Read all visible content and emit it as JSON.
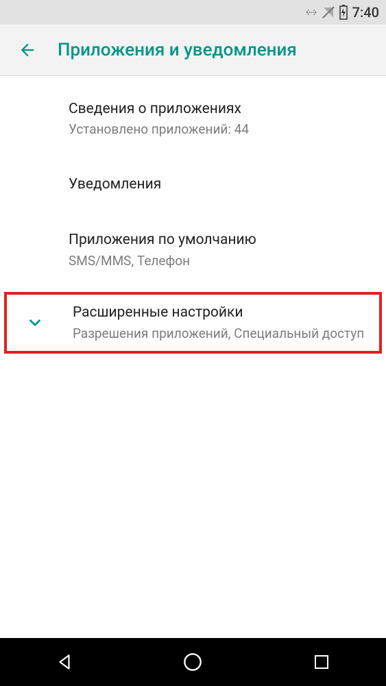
{
  "status": {
    "time": "7:40"
  },
  "header": {
    "title": "Приложения и уведомления"
  },
  "items": [
    {
      "title": "Сведения о приложениях",
      "subtitle": "Установлено приложений: 44"
    },
    {
      "title": "Уведомления",
      "subtitle": ""
    },
    {
      "title": "Приложения по умолчанию",
      "subtitle": "SMS/MMS, Телефон"
    },
    {
      "title": "Расширенные настройки",
      "subtitle": "Разрешения приложений, Специальный доступ"
    }
  ],
  "colors": {
    "accent": "#009688",
    "highlight": "#e02020"
  }
}
